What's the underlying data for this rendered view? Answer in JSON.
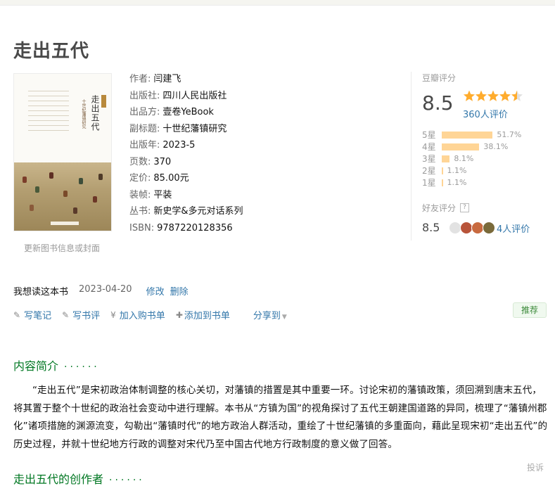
{
  "book": {
    "title": "走出五代",
    "cover_title": "走出五代",
    "cover_subtitle": "十世纪藩镇研究",
    "cover_update_link": "更新图书信息或封面"
  },
  "info": [
    {
      "key": "作者:",
      "value": "闫建飞",
      "link": true
    },
    {
      "key": "出版社:",
      "value": "四川人民出版社",
      "link": true
    },
    {
      "key": "出品方:",
      "value": "壹卷YeBook",
      "link": true
    },
    {
      "key": "副标题:",
      "value": "十世纪藩镇研究",
      "link": false
    },
    {
      "key": "出版年:",
      "value": "2023-5",
      "link": false
    },
    {
      "key": "页数:",
      "value": "370",
      "link": false
    },
    {
      "key": "定价:",
      "value": "85.00元",
      "link": false
    },
    {
      "key": "装帧:",
      "value": "平装",
      "link": false
    },
    {
      "key": "丛书:",
      "value": "新史学&多元对话系列",
      "link": true
    },
    {
      "key": "ISBN:",
      "value": "9787220128356",
      "link": false
    }
  ],
  "rating": {
    "label": "豆瓣评分",
    "score": "8.5",
    "stars": 4.5,
    "count": "360人评价",
    "distribution": [
      {
        "label": "5星",
        "pct": "51.7%",
        "value": 51.7
      },
      {
        "label": "4星",
        "pct": "38.1%",
        "value": 38.1
      },
      {
        "label": "3星",
        "pct": "8.1%",
        "value": 8.1
      },
      {
        "label": "2星",
        "pct": "1.1%",
        "value": 1.1
      },
      {
        "label": "1星",
        "pct": "1.1%",
        "value": 1.1
      }
    ],
    "friend_label": "好友评分",
    "friend_help": "?",
    "friend_score": "8.5",
    "friend_count": "4人评价",
    "star_color": "#ffac2d",
    "bar_color": "#ffd596"
  },
  "want": {
    "text": "我想读这本书",
    "date": "2023-04-20",
    "edit": "修改",
    "delete": "删除"
  },
  "actions": {
    "write_note": "写笔记",
    "write_review": "写书评",
    "add_cart": "加入购书单",
    "add_list": "添加到书单",
    "share": "分享到",
    "recommend": "推荐"
  },
  "sections": {
    "intro_title": "内容简介",
    "intro_dots": "······",
    "intro_text": "“走出五代”是宋初政治体制调整的核心关切，对藩镇的措置是其中重要一环。讨论宋初的藩镇政策，须回溯到唐末五代，将其置于整个十世纪的政治社会变动中进行理解。本书从“方镇为国”的视角探讨了五代王朝建国道路的异同，梳理了“藩镇州郡化”诸项措施的渊源流变，勾勒出“藩镇时代”的地方政治人群活动，重绘了十世纪藩镇的多重面向，藉此呈现宋初“走出五代”的历史过程，并就十世纪地方行政的调整对宋代乃至中国古代地方行政制度的意义做了回答。",
    "report": "投诉",
    "authors_title": "走出五代的创作者",
    "authors_dots": "······"
  },
  "colors": {
    "link": "#3377aa",
    "section": "#007722"
  }
}
